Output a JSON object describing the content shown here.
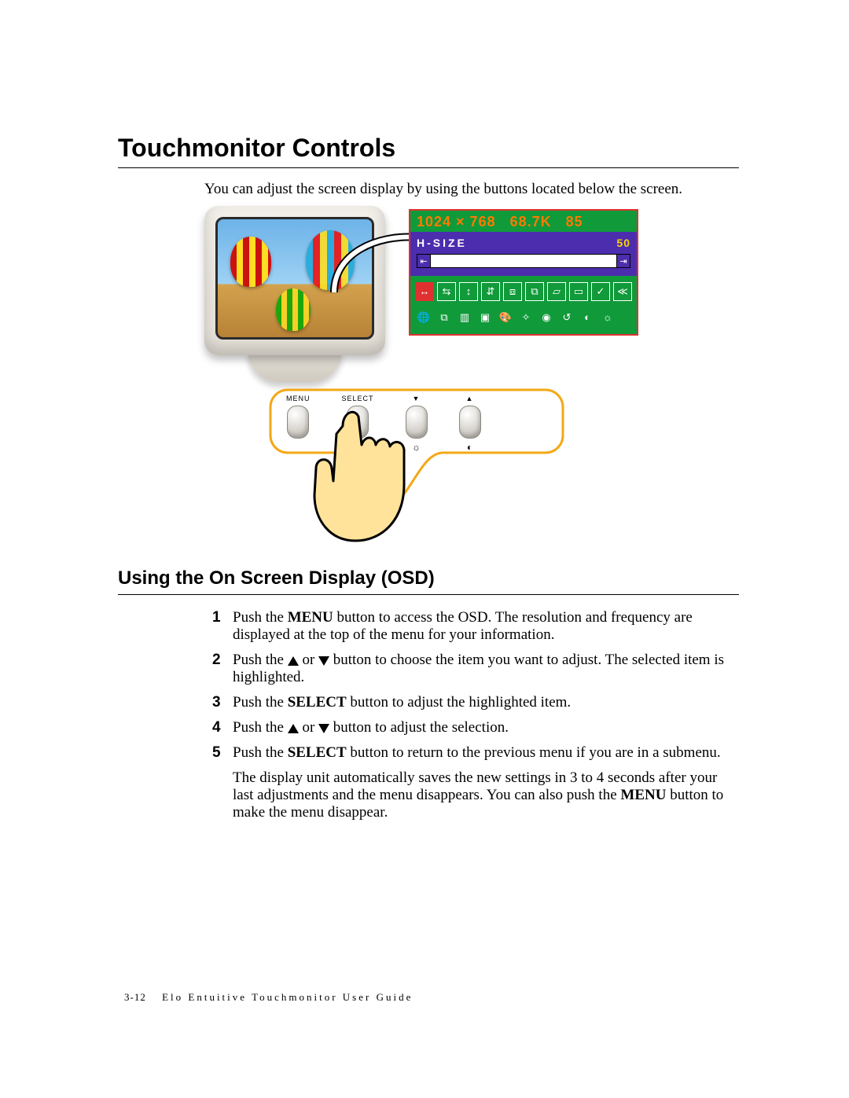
{
  "heading": "Touchmonitor Controls",
  "intro": "You can adjust the screen display by using the buttons located below the screen.",
  "osd": {
    "res": "1024 × 768",
    "khz": "68.7K",
    "hz": "85",
    "param": "H-SIZE",
    "value": "50",
    "row1_icons": [
      "h-size-icon",
      "h-pos-icon",
      "v-size-icon",
      "v-pos-icon",
      "pincushion-icon",
      "pinbalance-icon",
      "trapezoid-icon",
      "parallel-icon",
      "zoom-icon",
      "more-icon"
    ],
    "row2_icons": [
      "language-icon",
      "input-icon",
      "halftone-icon",
      "osd-icon",
      "color-icon",
      "degauss-icon",
      "moire-icon",
      "recall-icon",
      "contrast-icon",
      "brightness-icon"
    ]
  },
  "buttons": {
    "b1": "MENU",
    "b2": "SELECT",
    "b3_sym": "▼",
    "b4_sym": "▲",
    "b3_sub": "☼",
    "b4_sub": "◐"
  },
  "subheading": "Using the On Screen Display (OSD)",
  "steps": {
    "s1_a": "Push the ",
    "s1_b": "MENU",
    "s1_c": " button to access the OSD. The resolution and frequency are displayed at the top of the menu for your information.",
    "s2_a": "Push the ",
    "s2_b": " or ",
    "s2_c": " button to choose the item you want to adjust. The selected item is highlighted.",
    "s3_a": "Push the ",
    "s3_b": "SELECT",
    "s3_c": " button to adjust the highlighted item.",
    "s4_a": "Push the  ",
    "s4_b": " or ",
    "s4_c": "  button to adjust the selection.",
    "s5_a": "Push the ",
    "s5_b": "SELECT",
    "s5_c": " button to return to the previous menu if you are in a submenu."
  },
  "after_a": "The display unit automatically saves the new settings in 3 to 4 seconds after your last adjustments and the menu disappears. You can also push the ",
  "after_b": "MENU",
  "after_c": " button to make the menu disappear.",
  "footer_page": "3-12",
  "footer_title": "Elo Entuitive Touchmonitor User Guide"
}
